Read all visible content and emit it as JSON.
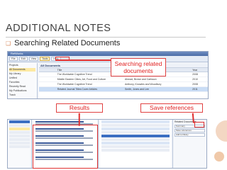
{
  "slide": {
    "title": "ADDITIONAL NOTES",
    "bullet_text": "Searching Related Documents"
  },
  "screenshot_top": {
    "window_title": "RefWorks",
    "ribbon_tabs": [
      "File",
      "Edit",
      "View",
      "Tools",
      "Help"
    ],
    "left_pane_items": [
      "Projects",
      "All Documents",
      "My Library",
      "Unfiled",
      "Favorites",
      "Recently Read",
      "My Publications",
      "Trash"
    ],
    "grid_toolbar_title": "All Documents",
    "grid_headers": [
      "",
      "Title",
      "Authors",
      "Year"
    ],
    "grid_rows": [
      {
        "c1": "",
        "c2": "The Worldwide Cognitive Trend",
        "c3": "Anthony, Knowles and Woodbury",
        "c4": "2008"
      },
      {
        "c1": "",
        "c2": "Middle Eastern Cities, Art, Food and Culture",
        "c3": "Ahmad, Brown and Carlsson",
        "c4": "2010"
      },
      {
        "c1": "",
        "c2": "The Worldwide Cognitive Trend",
        "c3": "Anthony, Knowles and Woodbury",
        "c4": "2008"
      },
      {
        "c1": "",
        "c2": "Related Journal Titles Cover Articles",
        "c3": "Smith, Jones and Lee",
        "c4": "2011"
      }
    ]
  },
  "screenshot_bottom": {
    "side_panel_title": "Related Documents",
    "side_panel_lines": [
      "Summary",
      "Save references",
      "Add to library"
    ]
  },
  "callouts": {
    "search": "Searching related documents",
    "results": "Results",
    "save": "Save references"
  },
  "colors": {
    "callout_red": "#e02020",
    "title_gray": "#404040",
    "accent_orange": "#d88a5c"
  }
}
